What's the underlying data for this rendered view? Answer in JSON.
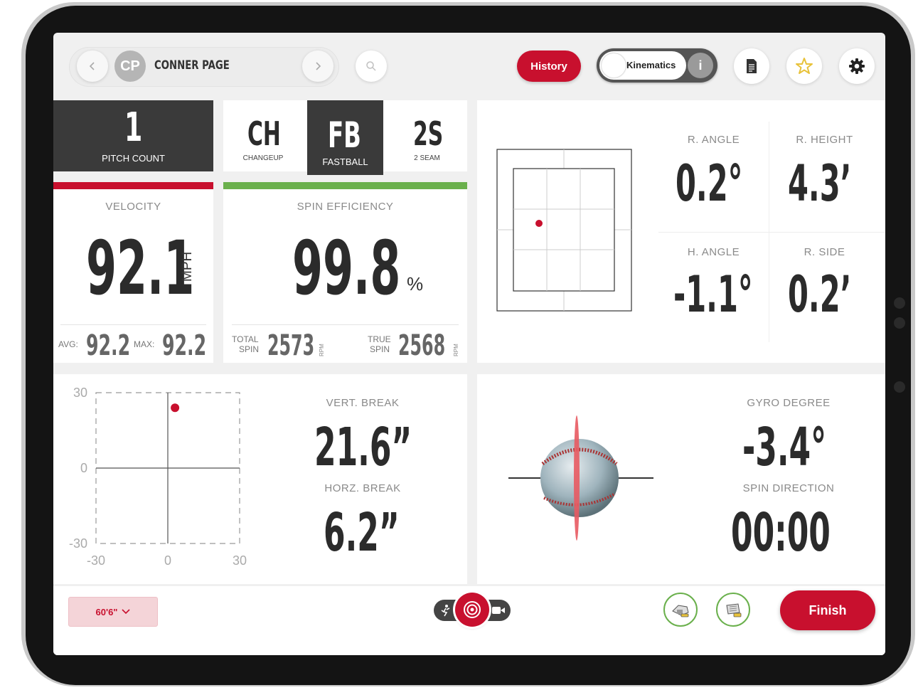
{
  "header": {
    "player_initials": "CP",
    "player_name": "CONNER PAGE",
    "history_label": "History",
    "kinematics_label": "Kinematics",
    "info_glyph": "i"
  },
  "pitch_count": {
    "value": "1",
    "label": "PITCH COUNT"
  },
  "pitch_types": [
    {
      "code": "CH",
      "name": "CHANGEUP",
      "selected": false
    },
    {
      "code": "FB",
      "name": "FASTBALL",
      "selected": true
    },
    {
      "code": "2S",
      "name": "2 SEAM",
      "selected": false
    }
  ],
  "velocity": {
    "title": "VELOCITY",
    "value": "92.1",
    "unit": "MPH",
    "avg_label": "AVG:",
    "avg": "92.2",
    "max_label": "MAX:",
    "max": "92.2"
  },
  "spin_efficiency": {
    "title": "SPIN EFFICIENCY",
    "value": "99.8",
    "unit": "%",
    "total_label_1": "TOTAL",
    "total_label_2": "SPIN",
    "total": "2573",
    "true_label_1": "TRUE",
    "true_label_2": "SPIN",
    "true": "2568",
    "rpm": "RPM"
  },
  "release": {
    "r_angle_label": "R. ANGLE",
    "r_angle": "0.2°",
    "r_height_label": "R. HEIGHT",
    "r_height": "4.3’",
    "h_angle_label": "H. ANGLE",
    "h_angle": "-1.1°",
    "r_side_label": "R. SIDE",
    "r_side": "0.2’"
  },
  "break_chart": {
    "y_ticks": [
      "30",
      "0",
      "-30"
    ],
    "x_ticks": [
      "-30",
      "0",
      "30"
    ],
    "point": {
      "x": 3,
      "y": 24
    }
  },
  "break": {
    "vert_label": "VERT. BREAK",
    "vert": "21.6”",
    "horz_label": "HORZ. BREAK",
    "horz": "6.2”"
  },
  "spin": {
    "gyro_label": "GYRO DEGREE",
    "gyro": "-3.4°",
    "dir_label": "SPIN DIRECTION",
    "dir": "00:00"
  },
  "footer": {
    "distance": "60'6\"",
    "finish_label": "Finish"
  },
  "colors": {
    "accent_red": "#c8102e",
    "green": "#6ab04c",
    "dark_tile": "#3a3a3a"
  }
}
